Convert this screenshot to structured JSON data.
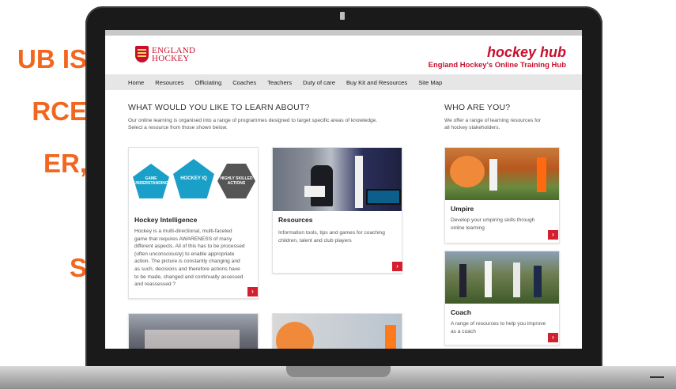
{
  "slide": {
    "headline_lines": [
      "UB IS",
      "RCE",
      "ER,",
      "",
      "S"
    ],
    "headline_color": "#f2661f"
  },
  "site": {
    "logo_line1": "ENGLAND",
    "logo_line2": "HOCKEY",
    "title": "hockey hub",
    "subtitle": "England Hockey's Online Training Hub",
    "brand_color": "#c8102e"
  },
  "nav": [
    "Home",
    "Resources",
    "Officiating",
    "Coaches",
    "Teachers",
    "Duty of care",
    "Buy Kit and Resources",
    "Site Map"
  ],
  "learn": {
    "heading": "WHAT WOULD YOU LIKE TO LEARN ABOUT?",
    "intro_line1": "Our online learning is organised into a range of programmes designed to target specific areas of knowledge.",
    "intro_line2": "Select a resource from those shown below.",
    "cards": [
      {
        "title": "Hockey Intelligence",
        "badges": [
          "GAME UNDERSTANDING",
          "HOCKEY IQ",
          "HIGHLY SKILLED ACTIONS"
        ],
        "desc": [
          "Hockey is a multi-directional, multi-faceted",
          "game that requires AWARENESS of many",
          "different aspects. All of this has to be processed",
          "(often unconsciously) to enable appropriate",
          "action. The picture is constantly changing and",
          "as such, decisions and therefore actions have",
          "to be made, changed and continually assessed",
          "and reassessed ?"
        ]
      },
      {
        "title": "Resources",
        "desc": [
          "Information tools, tips and games for coaching",
          "children, talent and club players"
        ]
      }
    ]
  },
  "who": {
    "heading": "WHO ARE YOU?",
    "intro_line1": "We offer a range of learning resources for",
    "intro_line2": "all hockey stakeholders.",
    "cards": [
      {
        "title": "Umpire",
        "desc": [
          "Develop your umpiring skills through",
          "online learning"
        ]
      },
      {
        "title": "Coach",
        "desc": [
          "A range of resources to help you improve",
          "as a coach"
        ]
      }
    ]
  },
  "arrow_glyph": "›"
}
